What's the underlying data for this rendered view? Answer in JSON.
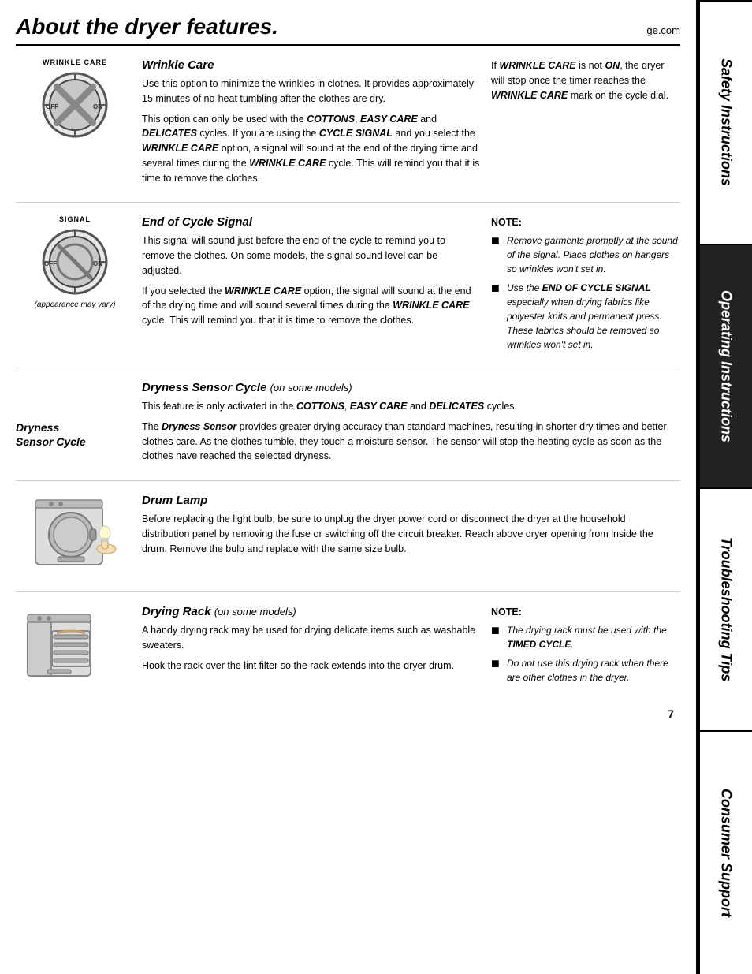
{
  "page": {
    "title": "About the dryer features.",
    "website": "ge.com",
    "page_number": "7"
  },
  "sidebar": {
    "tabs": [
      {
        "id": "safety",
        "label": "Safety Instructions",
        "active": false
      },
      {
        "id": "operating",
        "label": "Operating Instructions",
        "active": true
      },
      {
        "id": "troubleshooting",
        "label": "Troubleshooting Tips",
        "active": false
      },
      {
        "id": "consumer",
        "label": "Consumer Support",
        "active": false
      }
    ]
  },
  "sections": {
    "wrinkle_care": {
      "heading": "Wrinkle Care",
      "dial_label": "WRINKLE CARE",
      "body1": "Use this option to minimize the wrinkles in clothes. It provides approximately 15 minutes of no-heat tumbling after the clothes are dry.",
      "body2": "This option can only be used with the COTTONS, EASY CARE and DELICATES cycles. If you are using the CYCLE SIGNAL and you select the WRINKLE CARE option, a signal will sound at the end of the drying time and several times during the WRINKLE CARE cycle. This will remind you that it is time to remove the clothes.",
      "right_text": "If WRINKLE CARE is not ON, the dryer will stop once the timer reaches the WRINKLE CARE mark on the cycle dial."
    },
    "end_of_cycle": {
      "heading": "End of Cycle Signal",
      "dial_label": "SIGNAL",
      "appearance_note": "(appearance may vary)",
      "body1": "This signal will sound just before the end of the cycle to remind you to remove the clothes. On some models, the signal sound level can be adjusted.",
      "body2": "If you selected the WRINKLE CARE option, the signal will sound at the end of the drying time and will sound several times during the WRINKLE CARE cycle. This will remind you that it is time to remove the clothes.",
      "note_label": "NOTE:",
      "note_items": [
        "Remove garments promptly at the sound of the signal. Place clothes on hangers so wrinkles won't set in.",
        "Use the END OF CYCLE SIGNAL especially when drying fabrics like polyester knits and permanent press. These fabrics should be removed so wrinkles won't set in."
      ]
    },
    "dryness_sensor": {
      "heading": "Dryness Sensor Cycle",
      "heading_suffix": "(on some models)",
      "left_label_line1": "Dryness",
      "left_label_line2": "Sensor Cycle",
      "body1": "This feature is only activated in the COTTONS, EASY CARE and DELICATES cycles.",
      "body2": "The Dryness Sensor provides greater drying accuracy than standard machines, resulting in shorter dry times and better clothes care. As the clothes tumble, they touch a moisture sensor. The sensor will stop the heating cycle as soon as the clothes have reached the selected dryness."
    },
    "drum_lamp": {
      "heading": "Drum Lamp",
      "body1": "Before replacing the light bulb, be sure to unplug the dryer power cord or disconnect the dryer at the household distribution panel by removing the fuse or switching off the circuit breaker. Reach above dryer opening from inside the drum. Remove the bulb and replace with the same size bulb."
    },
    "drying_rack": {
      "heading": "Drying Rack",
      "heading_suffix": "(on some models)",
      "body1": "A handy drying rack may be used for drying delicate items such as washable sweaters.",
      "body2": "Hook the rack over the lint filter so the rack extends into the dryer drum.",
      "note_label": "NOTE:",
      "note_items": [
        "The drying rack must be used with the TIMED CYCLE.",
        "Do not use this drying rack when there are other clothes in the dryer."
      ]
    }
  }
}
